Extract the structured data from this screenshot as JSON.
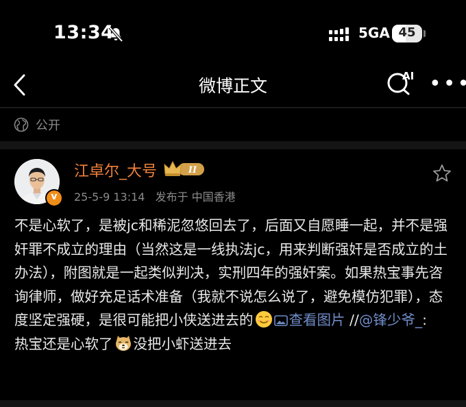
{
  "status_bar": {
    "time": "13:34",
    "network": "5GA",
    "battery": "45",
    "battery_level": 0.45
  },
  "nav": {
    "title": "微博正文",
    "ai_label": "AI"
  },
  "privacy": {
    "label": "公开"
  },
  "post": {
    "username": "江卓尔_大号",
    "rank_badge": "II",
    "verified_mark": "v",
    "date": "25-5-9 13:14",
    "location": "发布于 中国香港",
    "text_1": "不是心软了，是被jc和稀泥忽悠回去了，后面又自愿睡一起，并不是强奸罪不成立的理由（当然这是一线执法jc，用来判断强奸是否成立的土办法），附图就是一起类似判决，实刑四年的强奸案。如果热宝事先咨询律师，做好充足话术准备（我就不说怎么说了，避免模仿犯罪），态度坚定强硬，是很可能把小侠送进去的",
    "view_image_label": "查看图片",
    "repost_sep": " //",
    "mention": "@锋少爷_",
    "text_2": ":",
    "text_3": "热宝还是心软了",
    "text_4": "没把小虾送进去"
  },
  "colors": {
    "background": "#000000",
    "username": "#f0803c",
    "link": "#6f8cc8",
    "meta": "#8b8b8b"
  },
  "icons": [
    "bell-off-icon",
    "signal-icon",
    "back-icon",
    "ai-search-icon",
    "more-icon",
    "globe-icon",
    "crown-icon",
    "star-icon",
    "smile-emoji-icon",
    "image-icon",
    "doge-emoji-icon"
  ]
}
